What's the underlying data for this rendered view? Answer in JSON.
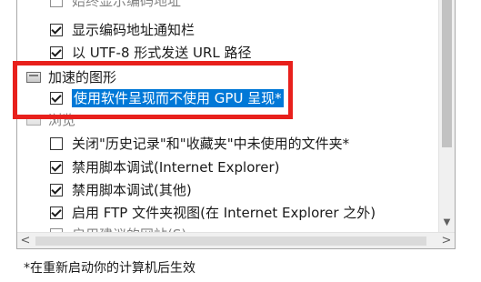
{
  "list": {
    "items": [
      {
        "label": "始终显示编码地址",
        "checked": false,
        "type": "item"
      },
      {
        "label": "显示编码地址通知栏",
        "checked": true,
        "type": "item"
      },
      {
        "label": "以 UTF-8 形式发送 URL 路径",
        "checked": true,
        "type": "item"
      },
      {
        "label": "加速的图形",
        "type": "group"
      },
      {
        "label": "使用软件呈现而不使用 GPU 呈现*",
        "checked": true,
        "type": "item",
        "selected": true
      },
      {
        "label": "浏览",
        "type": "group"
      },
      {
        "label": "关闭\"历史记录\"和\"收藏夹\"中未使用的文件夹*",
        "checked": false,
        "type": "item"
      },
      {
        "label": "禁用脚本调试(Internet Explorer)",
        "checked": true,
        "type": "item"
      },
      {
        "label": "禁用脚本调试(其他)",
        "checked": true,
        "type": "item"
      },
      {
        "label": "启用 FTP 文件夹视图(在 Internet Explorer 之外)",
        "checked": true,
        "type": "item"
      },
      {
        "label": "启用建议的网站(S)",
        "checked": false,
        "type": "item"
      }
    ]
  },
  "scrollbar": {
    "left_arrow": "<",
    "right_arrow": ">",
    "down_arrow": "▼"
  },
  "footnote": "*在重新启动你的计算机后生效",
  "colors": {
    "highlight_border": "#e8201c",
    "selection": "#0078d7"
  }
}
